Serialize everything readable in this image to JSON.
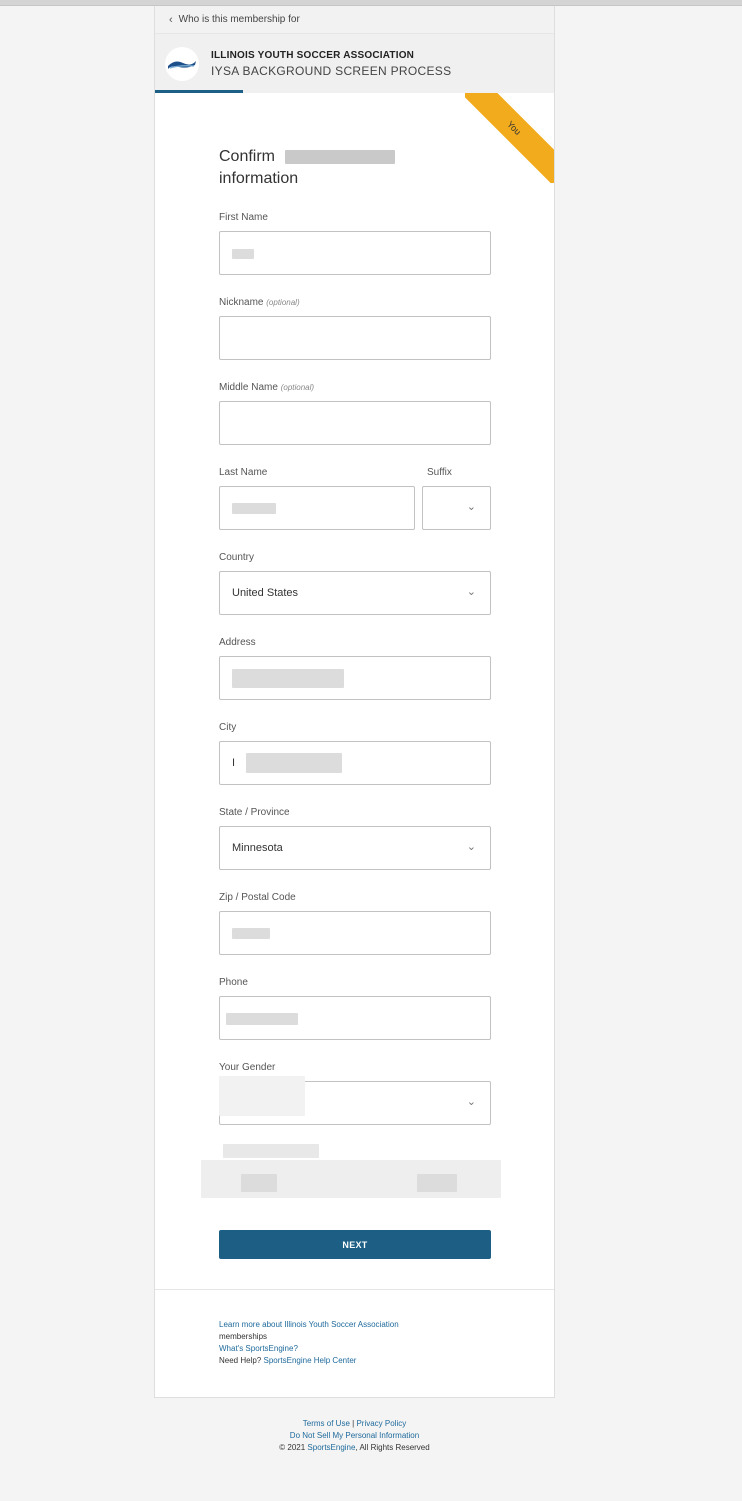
{
  "back_link": {
    "label": "Who is this membership for"
  },
  "org": {
    "name": "ILLINOIS YOUTH SOCCER ASSOCIATION",
    "program": "IYSA BACKGROUND SCREEN PROCESS"
  },
  "ribbon": {
    "label": "You"
  },
  "form": {
    "title_line1": "Confirm",
    "title_line2": "information",
    "optional_tag": "(optional)",
    "labels": {
      "first_name": "First Name",
      "nickname": "Nickname",
      "middle_name": "Middle Name",
      "last_name": "Last Name",
      "suffix": "Suffix",
      "country": "Country",
      "address": "Address",
      "city": "City",
      "state": "State / Province",
      "zip": "Zip / Postal Code",
      "phone": "Phone",
      "gender": "Your Gender"
    },
    "values": {
      "country": "United States",
      "state": "Minnesota",
      "city_initial": "I"
    },
    "next_label": "NEXT"
  },
  "help": {
    "learn_more": "Learn more about Illinois Youth Soccer Association",
    "learn_more_tail": "memberships",
    "whats_se": "What's SportsEngine?",
    "need_help": "Need Help?",
    "help_center": "SportsEngine Help Center"
  },
  "footer": {
    "terms": "Terms of Use",
    "sep": "|",
    "privacy": "Privacy Policy",
    "do_not_sell": "Do Not Sell My Personal Information",
    "copyright_prefix": "© 2021",
    "brand": "SportsEngine",
    "copyright_suffix": ", All Rights Reserved"
  },
  "colors": {
    "accent": "#1c5e84",
    "ribbon": "#f1ab1c",
    "link": "#1f6a9c"
  },
  "icons": {
    "back": "chevron-left-icon",
    "dropdown": "chevron-down-icon",
    "logo": "org-logo-icon"
  }
}
